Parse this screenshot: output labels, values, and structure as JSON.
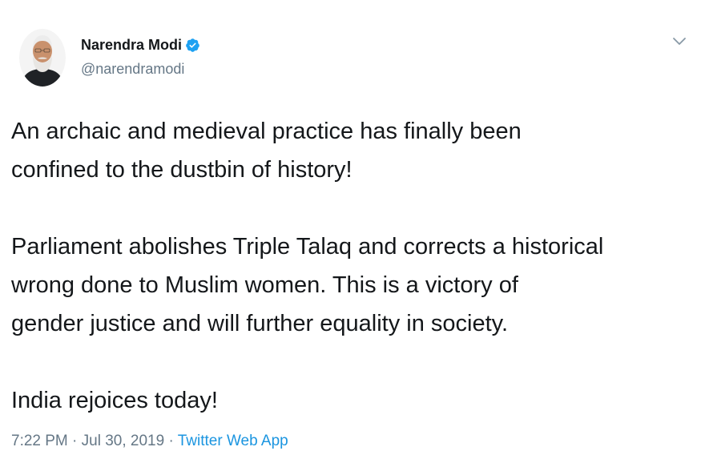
{
  "user": {
    "display_name": "Narendra Modi",
    "handle": "@narendramodi",
    "verified": true,
    "avatar_icon": "profile-photo"
  },
  "menu": {
    "icon": "chevron-down-icon"
  },
  "tweet": {
    "paragraph1": "An archaic and medieval practice has finally been\nconfined to the dustbin of history!",
    "paragraph2": "Parliament abolishes Triple Talaq and corrects a historical\nwrong done to Muslim women. This is a victory of\ngender justice and will further equality in society.",
    "paragraph3": "India rejoices today!"
  },
  "meta": {
    "time": "7:22 PM",
    "separator1": " · ",
    "date": "Jul 30, 2019",
    "separator2": " · ",
    "source": "Twitter Web App"
  },
  "colors": {
    "text": "#14171a",
    "secondary": "#657786",
    "link": "#1b95e0",
    "verified_badge": "#1da1f2"
  }
}
